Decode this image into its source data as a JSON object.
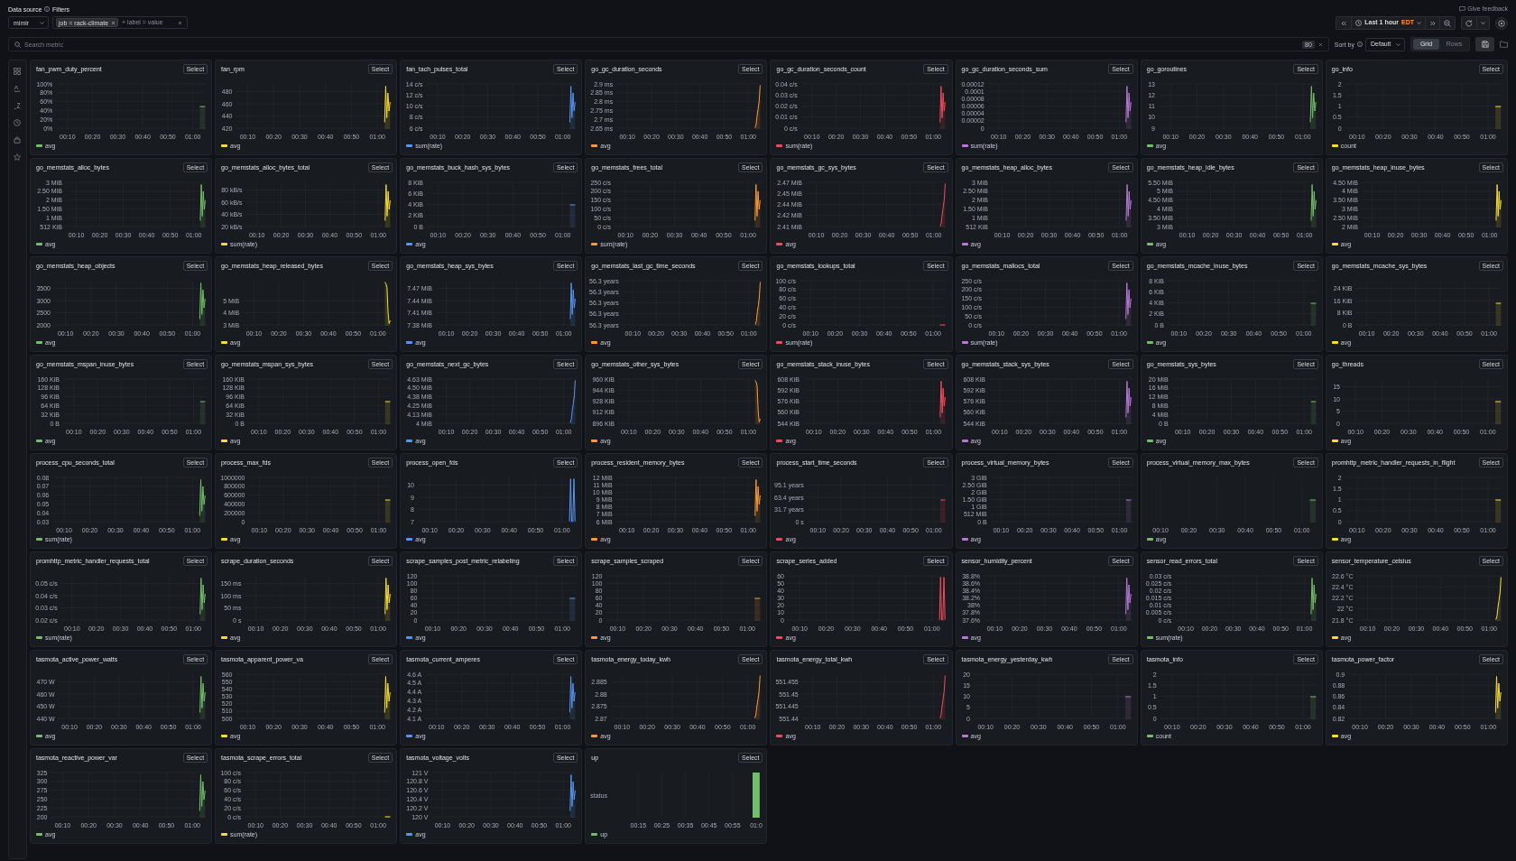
{
  "toolbar": {
    "datasource": {
      "label": "Data source",
      "value": "mimir"
    },
    "filters": {
      "label": "Filters",
      "chips": [
        "job = rack-climate"
      ],
      "placeholder": "+ label = value"
    },
    "feedback": "Give feedback",
    "time_range": {
      "value": "Last 1 hour",
      "timezone": "EDT"
    }
  },
  "search": {
    "placeholder": "Search metric",
    "count": "80"
  },
  "sort": {
    "label": "Sort by",
    "value": "Default"
  },
  "view_modes": [
    {
      "label": "Grid",
      "selected": true
    },
    {
      "label": "Rows",
      "selected": false
    }
  ],
  "panels": [
    {
      "kind": "flat",
      "title": "fan_pwm_duty_percent",
      "action": "Select",
      "y_ticks": [
        "100%",
        "80%",
        "60%",
        "40%",
        "20%",
        "0%"
      ],
      "x_ticks": [
        "00:10",
        "00:20",
        "00:30",
        "00:40",
        "00:50",
        "01:00"
      ],
      "legend": [
        {
          "label": "avg",
          "color": "#73bf69"
        }
      ]
    },
    {
      "kind": "spikes",
      "title": "fan_rpm",
      "action": "Select",
      "y_ticks": [
        "480",
        "460",
        "440",
        "420"
      ],
      "x_ticks": [
        "00:10",
        "00:20",
        "00:30",
        "00:40",
        "00:50",
        "01:00"
      ],
      "legend": [
        {
          "label": "avg",
          "color": "#fade2a"
        }
      ]
    },
    {
      "kind": "spikes",
      "title": "fan_tach_pulses_total",
      "action": "Select",
      "y_ticks": [
        "14 c/s",
        "12 c/s",
        "10 c/s",
        "8 c/s",
        "6 c/s"
      ],
      "x_ticks": [
        "00:10",
        "00:20",
        "00:30",
        "00:40",
        "00:50",
        "01:00"
      ],
      "legend": [
        {
          "label": "sum(rate)",
          "color": "#5794f2"
        }
      ]
    },
    {
      "kind": "rise",
      "title": "go_gc_duration_seconds",
      "action": "Select",
      "y_ticks": [
        "2.9 ms",
        "2.85 ms",
        "2.8 ms",
        "2.75 ms",
        "2.7 ms",
        "2.65 ms"
      ],
      "x_ticks": [
        "00:10",
        "00:20",
        "00:30",
        "00:40",
        "00:50",
        "01:00"
      ],
      "legend": [
        {
          "label": "avg",
          "color": "#ff9830"
        }
      ]
    },
    {
      "kind": "spikes",
      "title": "go_gc_duration_seconds_count",
      "action": "Select",
      "y_ticks": [
        "0.04 c/s",
        "0.03 c/s",
        "0.02 c/s",
        "0.01 c/s",
        "0 c/s"
      ],
      "x_ticks": [
        "00:10",
        "00:20",
        "00:30",
        "00:40",
        "00:50",
        "01:00"
      ],
      "legend": [
        {
          "label": "sum(rate)",
          "color": "#f2495c"
        }
      ]
    },
    {
      "kind": "spikes",
      "title": "go_gc_duration_seconds_sum",
      "action": "Select",
      "y_ticks": [
        "0.00012",
        "0.0001",
        "0.00008",
        "0.00006",
        "0.00004",
        "0.00002",
        "0"
      ],
      "x_ticks": [
        "00:10",
        "00:20",
        "00:30",
        "00:40",
        "00:50",
        "01:00"
      ],
      "legend": [
        {
          "label": "sum(rate)",
          "color": "#b877d9"
        }
      ]
    },
    {
      "kind": "spikes",
      "title": "go_goroutines",
      "action": "Select",
      "y_ticks": [
        "13",
        "12",
        "11",
        "10",
        "9"
      ],
      "x_ticks": [
        "00:10",
        "00:20",
        "00:30",
        "00:40",
        "00:50",
        "01:00"
      ],
      "legend": [
        {
          "label": "avg",
          "color": "#73bf69"
        }
      ]
    },
    {
      "kind": "flat",
      "title": "go_info",
      "action": "Select",
      "y_ticks": [
        "2",
        "1.5",
        "1",
        "0.5",
        "0"
      ],
      "x_ticks": [
        "00:10",
        "00:20",
        "00:30",
        "00:40",
        "00:50",
        "01:00"
      ],
      "legend": [
        {
          "label": "count",
          "color": "#fade2a"
        }
      ]
    },
    {
      "kind": "spikes",
      "title": "go_memstats_alloc_bytes",
      "action": "Select",
      "y_ticks": [
        "3 MiB",
        "2.50 MiB",
        "2 MiB",
        "1.50 MiB",
        "1 MiB",
        "512 KiB"
      ],
      "x_ticks": [
        "00:10",
        "00:20",
        "00:30",
        "00:40",
        "00:50",
        "01:00"
      ],
      "legend": [
        {
          "label": "avg",
          "color": "#73bf69"
        }
      ]
    },
    {
      "kind": "spikes",
      "title": "go_memstats_alloc_bytes_total",
      "action": "Select",
      "y_ticks": [
        "80 kB/s",
        "60 kB/s",
        "40 kB/s",
        "20 kB/s"
      ],
      "x_ticks": [
        "00:10",
        "00:20",
        "00:30",
        "00:40",
        "00:50",
        "01:00"
      ],
      "legend": [
        {
          "label": "sum(rate)",
          "color": "#fade2a"
        }
      ]
    },
    {
      "kind": "flat",
      "title": "go_memstats_buck_hash_sys_bytes",
      "action": "Select",
      "y_ticks": [
        "8 KiB",
        "6 KiB",
        "4 KiB",
        "2 KiB",
        "0 B"
      ],
      "x_ticks": [
        "00:10",
        "00:20",
        "00:30",
        "00:40",
        "00:50",
        "01:00"
      ],
      "legend": [
        {
          "label": "avg",
          "color": "#5794f2"
        }
      ]
    },
    {
      "kind": "spikes",
      "title": "go_memstats_frees_total",
      "action": "Select",
      "y_ticks": [
        "250 c/s",
        "200 c/s",
        "150 c/s",
        "100 c/s",
        "50 c/s",
        "0 c/s"
      ],
      "x_ticks": [
        "00:10",
        "00:20",
        "00:30",
        "00:40",
        "00:50",
        "01:00"
      ],
      "legend": [
        {
          "label": "sum(rate)",
          "color": "#ff9830"
        }
      ]
    },
    {
      "kind": "rise",
      "title": "go_memstats_gc_sys_bytes",
      "action": "Select",
      "y_ticks": [
        "2.47 MiB",
        "2.45 MiB",
        "2.44 MiB",
        "2.42 MiB",
        "2.41 MiB"
      ],
      "x_ticks": [
        "00:10",
        "00:20",
        "00:30",
        "00:40",
        "00:50",
        "01:00"
      ],
      "legend": [
        {
          "label": "avg",
          "color": "#f2495c"
        }
      ]
    },
    {
      "kind": "spikes",
      "title": "go_memstats_heap_alloc_bytes",
      "action": "Select",
      "y_ticks": [
        "3 MiB",
        "2.50 MiB",
        "2 MiB",
        "1.50 MiB",
        "1 MiB",
        "512 KiB"
      ],
      "x_ticks": [
        "00:10",
        "00:20",
        "00:30",
        "00:40",
        "00:50",
        "01:00"
      ],
      "legend": [
        {
          "label": "avg",
          "color": "#b877d9"
        }
      ]
    },
    {
      "kind": "spikes",
      "title": "go_memstats_heap_idle_bytes",
      "action": "Select",
      "y_ticks": [
        "5.50 MiB",
        "5 MiB",
        "4.50 MiB",
        "4 MiB",
        "3.50 MiB",
        "3 MiB"
      ],
      "x_ticks": [
        "00:10",
        "00:20",
        "00:30",
        "00:40",
        "00:50",
        "01:00"
      ],
      "legend": [
        {
          "label": "avg",
          "color": "#73bf69"
        }
      ]
    },
    {
      "kind": "spikes",
      "title": "go_memstats_heap_inuse_bytes",
      "action": "Select",
      "y_ticks": [
        "4.50 MiB",
        "4 MiB",
        "3.50 MiB",
        "3 MiB",
        "2.50 MiB",
        "2 MiB"
      ],
      "x_ticks": [
        "00:10",
        "00:20",
        "00:30",
        "00:40",
        "00:50",
        "01:00"
      ],
      "legend": [
        {
          "label": "avg",
          "color": "#fade2a"
        }
      ]
    },
    {
      "kind": "spikes",
      "title": "go_memstats_heap_objects",
      "action": "Select",
      "y_ticks": [
        "3500",
        "3000",
        "2500",
        "2000"
      ],
      "x_ticks": [
        "00:10",
        "00:20",
        "00:30",
        "00:40",
        "00:50",
        "01:00"
      ],
      "legend": [
        {
          "label": "avg",
          "color": "#73bf69"
        }
      ]
    },
    {
      "kind": "fall",
      "title": "go_memstats_heap_released_bytes",
      "action": "Select",
      "y_ticks": [
        "5 MiB",
        "4 MiB",
        "3 MiB"
      ],
      "x_ticks": [
        "00:10",
        "00:20",
        "00:30",
        "00:40",
        "00:50",
        "01:00"
      ],
      "legend": [
        {
          "label": "avg",
          "color": "#fade2a"
        }
      ]
    },
    {
      "kind": "spikes",
      "title": "go_memstats_heap_sys_bytes",
      "action": "Select",
      "y_ticks": [
        "7.47 MiB",
        "7.44 MiB",
        "7.41 MiB",
        "7.38 MiB"
      ],
      "x_ticks": [
        "00:10",
        "00:20",
        "00:30",
        "00:40",
        "00:50",
        "01:00"
      ],
      "legend": [
        {
          "label": "avg",
          "color": "#5794f2"
        }
      ]
    },
    {
      "kind": "rise",
      "title": "go_memstats_last_gc_time_seconds",
      "action": "Select",
      "y_ticks": [
        "56.3 years",
        "56.3 years",
        "56.3 years",
        "56.3 years",
        "56.3 years"
      ],
      "x_ticks": [
        "00:10",
        "00:20",
        "00:30",
        "00:40",
        "00:50",
        "01:00"
      ],
      "legend": [
        {
          "label": "avg",
          "color": "#ff9830"
        }
      ]
    },
    {
      "kind": "zero",
      "title": "go_memstats_lookups_total",
      "action": "Select",
      "y_ticks": [
        "100 c/s",
        "80 c/s",
        "60 c/s",
        "40 c/s",
        "20 c/s",
        "0 c/s"
      ],
      "x_ticks": [
        "00:10",
        "00:20",
        "00:30",
        "00:40",
        "00:50",
        "01:00"
      ],
      "legend": [
        {
          "label": "sum(rate)",
          "color": "#f2495c"
        }
      ]
    },
    {
      "kind": "spikes",
      "title": "go_memstats_mallocs_total",
      "action": "Select",
      "y_ticks": [
        "250 c/s",
        "200 c/s",
        "150 c/s",
        "100 c/s",
        "50 c/s",
        "0 c/s"
      ],
      "x_ticks": [
        "00:10",
        "00:20",
        "00:30",
        "00:40",
        "00:50",
        "01:00"
      ],
      "legend": [
        {
          "label": "sum(rate)",
          "color": "#b877d9"
        }
      ]
    },
    {
      "kind": "flat",
      "title": "go_memstats_mcache_inuse_bytes",
      "action": "Select",
      "y_ticks": [
        "8 KiB",
        "6 KiB",
        "4 KiB",
        "2 KiB",
        "0 B"
      ],
      "x_ticks": [
        "00:10",
        "00:20",
        "00:30",
        "00:40",
        "00:50",
        "01:00"
      ],
      "legend": [
        {
          "label": "avg",
          "color": "#73bf69"
        }
      ]
    },
    {
      "kind": "flat",
      "title": "go_memstats_mcache_sys_bytes",
      "action": "Select",
      "y_ticks": [
        "24 KiB",
        "16 KiB",
        "8 KiB",
        "0 B"
      ],
      "x_ticks": [
        "00:10",
        "00:20",
        "00:30",
        "00:40",
        "00:50",
        "01:00"
      ],
      "legend": [
        {
          "label": "avg",
          "color": "#fade2a"
        }
      ]
    },
    {
      "kind": "flat",
      "title": "go_memstats_mspan_inuse_bytes",
      "action": "Select",
      "y_ticks": [
        "160 KiB",
        "128 KiB",
        "96 KiB",
        "64 KiB",
        "32 KiB",
        "0 B"
      ],
      "x_ticks": [
        "00:10",
        "00:20",
        "00:30",
        "00:40",
        "00:50",
        "01:00"
      ],
      "legend": [
        {
          "label": "avg",
          "color": "#73bf69"
        }
      ]
    },
    {
      "kind": "flat",
      "title": "go_memstats_mspan_sys_bytes",
      "action": "Select",
      "y_ticks": [
        "160 KiB",
        "128 KiB",
        "96 KiB",
        "64 KiB",
        "32 KiB",
        "0 B"
      ],
      "x_ticks": [
        "00:10",
        "00:20",
        "00:30",
        "00:40",
        "00:50",
        "01:00"
      ],
      "legend": [
        {
          "label": "avg",
          "color": "#fade2a"
        }
      ]
    },
    {
      "kind": "rise",
      "title": "go_memstats_next_gc_bytes",
      "action": "Select",
      "y_ticks": [
        "4.63 MiB",
        "4.50 MiB",
        "4.38 MiB",
        "4.25 MiB",
        "4.13 MiB",
        "4 MiB"
      ],
      "x_ticks": [
        "00:10",
        "00:20",
        "00:30",
        "00:40",
        "00:50",
        "01:00"
      ],
      "legend": [
        {
          "label": "avg",
          "color": "#5794f2"
        }
      ]
    },
    {
      "kind": "fall",
      "title": "go_memstats_other_sys_bytes",
      "action": "Select",
      "y_ticks": [
        "960 KiB",
        "944 KiB",
        "928 KiB",
        "912 KiB",
        "896 KiB"
      ],
      "x_ticks": [
        "00:10",
        "00:20",
        "00:30",
        "00:40",
        "00:50",
        "01:00"
      ],
      "legend": [
        {
          "label": "avg",
          "color": "#ff9830"
        }
      ]
    },
    {
      "kind": "spikes",
      "title": "go_memstats_stack_inuse_bytes",
      "action": "Select",
      "y_ticks": [
        "608 KiB",
        "592 KiB",
        "576 KiB",
        "560 KiB",
        "544 KiB"
      ],
      "x_ticks": [
        "00:10",
        "00:20",
        "00:30",
        "00:40",
        "00:50",
        "01:00"
      ],
      "legend": [
        {
          "label": "avg",
          "color": "#f2495c"
        }
      ]
    },
    {
      "kind": "spikes",
      "title": "go_memstats_stack_sys_bytes",
      "action": "Select",
      "y_ticks": [
        "608 KiB",
        "592 KiB",
        "576 KiB",
        "560 KiB",
        "544 KiB"
      ],
      "x_ticks": [
        "00:10",
        "00:20",
        "00:30",
        "00:40",
        "00:50",
        "01:00"
      ],
      "legend": [
        {
          "label": "avg",
          "color": "#b877d9"
        }
      ]
    },
    {
      "kind": "flat",
      "title": "go_memstats_sys_bytes",
      "action": "Select",
      "y_ticks": [
        "20 MiB",
        "16 MiB",
        "12 MiB",
        "8 MiB",
        "4 MiB",
        "0 B"
      ],
      "x_ticks": [
        "00:10",
        "00:20",
        "00:30",
        "00:40",
        "00:50",
        "01:00"
      ],
      "legend": [
        {
          "label": "avg",
          "color": "#73bf69"
        }
      ]
    },
    {
      "kind": "flat",
      "title": "go_threads",
      "action": "Select",
      "y_ticks": [
        "15",
        "10",
        "5",
        "0"
      ],
      "x_ticks": [
        "00:10",
        "00:20",
        "00:30",
        "00:40",
        "00:50",
        "01:00"
      ],
      "legend": [
        {
          "label": "avg",
          "color": "#fade2a"
        }
      ]
    },
    {
      "kind": "spikes",
      "title": "process_cpu_seconds_total",
      "action": "Select",
      "y_ticks": [
        "0.08",
        "0.07",
        "0.06",
        "0.05",
        "0.04",
        "0.03"
      ],
      "x_ticks": [
        "00:10",
        "00:20",
        "00:30",
        "00:40",
        "00:50",
        "01:00"
      ],
      "legend": [
        {
          "label": "sum(rate)",
          "color": "#73bf69"
        }
      ]
    },
    {
      "kind": "flat",
      "title": "process_max_fds",
      "action": "Select",
      "y_ticks": [
        "1000000",
        "800000",
        "600000",
        "400000",
        "200000",
        "0"
      ],
      "x_ticks": [
        "00:10",
        "00:20",
        "00:30",
        "00:40",
        "00:50",
        "01:00"
      ],
      "legend": [
        {
          "label": "avg",
          "color": "#fade2a"
        }
      ]
    },
    {
      "kind": "pulses",
      "title": "process_open_fds",
      "action": "Select",
      "y_ticks": [
        "10",
        "9",
        "8",
        "7"
      ],
      "x_ticks": [
        "00:10",
        "00:20",
        "00:30",
        "00:40",
        "00:50",
        "01:00"
      ],
      "legend": [
        {
          "label": "avg",
          "color": "#5794f2"
        }
      ]
    },
    {
      "kind": "spikes",
      "title": "process_resident_memory_bytes",
      "action": "Select",
      "y_ticks": [
        "12 MiB",
        "11 MiB",
        "10 MiB",
        "9 MiB",
        "8 MiB",
        "7 MiB",
        "6 MiB"
      ],
      "x_ticks": [
        "00:10",
        "00:20",
        "00:30",
        "00:40",
        "00:50",
        "01:00"
      ],
      "legend": [
        {
          "label": "avg",
          "color": "#ff9830"
        }
      ]
    },
    {
      "kind": "flat",
      "title": "process_start_time_seconds",
      "action": "Select",
      "y_ticks": [
        "95.1 years",
        "63.4 years",
        "31.7 years",
        "0 s"
      ],
      "x_ticks": [
        "00:10",
        "00:20",
        "00:30",
        "00:40",
        "00:50",
        "01:00"
      ],
      "legend": [
        {
          "label": "avg",
          "color": "#f2495c"
        }
      ]
    },
    {
      "kind": "flat",
      "title": "process_virtual_memory_bytes",
      "action": "Select",
      "y_ticks": [
        "3 GiB",
        "2.50 GiB",
        "2 GiB",
        "1.50 GiB",
        "1 GiB",
        "512 MiB",
        "0 B"
      ],
      "x_ticks": [
        "00:10",
        "00:20",
        "00:30",
        "00:40",
        "00:50",
        "01:00"
      ],
      "legend": [
        {
          "label": "avg",
          "color": "#b877d9"
        }
      ]
    },
    {
      "kind": "flat",
      "title": "process_virtual_memory_max_bytes",
      "action": "Select",
      "x_ticks": [
        "00:10",
        "00:20",
        "00:30",
        "00:40",
        "00:50",
        "01:00"
      ],
      "legend": [
        {
          "label": "avg",
          "color": "#73bf69"
        }
      ]
    },
    {
      "kind": "flat",
      "title": "promhttp_metric_handler_requests_in_flight",
      "action": "Select",
      "y_ticks": [
        "2",
        "1.5",
        "1",
        "0.5",
        "0"
      ],
      "x_ticks": [
        "00:10",
        "00:20",
        "00:30",
        "00:40",
        "00:50",
        "01:00"
      ],
      "legend": [
        {
          "label": "avg",
          "color": "#fade2a"
        }
      ]
    },
    {
      "kind": "spikes",
      "title": "promhttp_metric_handler_requests_total",
      "action": "Select",
      "y_ticks": [
        "0.05 c/s",
        "0.04 c/s",
        "0.03 c/s",
        "0.02 c/s"
      ],
      "x_ticks": [
        "00:10",
        "00:20",
        "00:30",
        "00:40",
        "00:50",
        "01:00"
      ],
      "legend": [
        {
          "label": "sum(rate)",
          "color": "#73bf69"
        }
      ]
    },
    {
      "kind": "spikes",
      "title": "scrape_duration_seconds",
      "action": "Select",
      "y_ticks": [
        "150 ms",
        "100 ms",
        "50 ms",
        "0 s"
      ],
      "x_ticks": [
        "00:10",
        "00:20",
        "00:30",
        "00:40",
        "00:50",
        "01:00"
      ],
      "legend": [
        {
          "label": "avg",
          "color": "#fade2a"
        }
      ]
    },
    {
      "kind": "flat",
      "title": "scrape_samples_post_metric_relabeling",
      "action": "Select",
      "y_ticks": [
        "120",
        "100",
        "80",
        "60",
        "40",
        "20",
        "0"
      ],
      "x_ticks": [
        "00:10",
        "00:20",
        "00:30",
        "00:40",
        "00:50",
        "01:00"
      ],
      "legend": [
        {
          "label": "avg",
          "color": "#5794f2"
        }
      ]
    },
    {
      "kind": "flat",
      "title": "scrape_samples_scraped",
      "action": "Select",
      "y_ticks": [
        "120",
        "100",
        "80",
        "60",
        "40",
        "20",
        "0"
      ],
      "x_ticks": [
        "00:10",
        "00:20",
        "00:30",
        "00:40",
        "00:50",
        "01:00"
      ],
      "legend": [
        {
          "label": "avg",
          "color": "#ff9830"
        }
      ]
    },
    {
      "kind": "pulses",
      "title": "scrape_series_added",
      "action": "Select",
      "y_ticks": [
        "60",
        "50",
        "40",
        "30",
        "20",
        "10",
        "0"
      ],
      "x_ticks": [
        "00:10",
        "00:20",
        "00:30",
        "00:40",
        "00:50",
        "01:00"
      ],
      "legend": [
        {
          "label": "avg",
          "color": "#f2495c"
        }
      ]
    },
    {
      "kind": "spikes",
      "title": "sensor_humidity_percent",
      "action": "Select",
      "y_ticks": [
        "38.8%",
        "38.6%",
        "38.4%",
        "38.2%",
        "38%",
        "37.8%",
        "37.6%"
      ],
      "x_ticks": [
        "00:10",
        "00:20",
        "00:30",
        "00:40",
        "00:50",
        "01:00"
      ],
      "legend": [
        {
          "label": "avg",
          "color": "#b877d9"
        }
      ]
    },
    {
      "kind": "spikes",
      "title": "sensor_read_errors_total",
      "action": "Select",
      "y_ticks": [
        "0.03 c/s",
        "0.025 c/s",
        "0.02 c/s",
        "0.015 c/s",
        "0.01 c/s",
        "0.005 c/s",
        "0 c/s"
      ],
      "x_ticks": [
        "00:10",
        "00:20",
        "00:30",
        "00:40",
        "00:50",
        "01:00"
      ],
      "legend": [
        {
          "label": "sum(rate)",
          "color": "#73bf69"
        }
      ]
    },
    {
      "kind": "rise",
      "title": "sensor_temperature_celsius",
      "action": "Select",
      "y_ticks": [
        "22.6 °C",
        "22.4 °C",
        "22.2 °C",
        "22 °C",
        "21.8 °C"
      ],
      "x_ticks": [
        "00:10",
        "00:20",
        "00:30",
        "00:40",
        "00:50",
        "01:00"
      ],
      "legend": [
        {
          "label": "avg",
          "color": "#fade2a"
        }
      ]
    },
    {
      "kind": "spikes",
      "title": "tasmota_active_power_watts",
      "action": "Select",
      "y_ticks": [
        "470 W",
        "460 W",
        "450 W",
        "440 W"
      ],
      "x_ticks": [
        "00:10",
        "00:20",
        "00:30",
        "00:40",
        "00:50",
        "01:00"
      ],
      "legend": [
        {
          "label": "avg",
          "color": "#73bf69"
        }
      ]
    },
    {
      "kind": "spikes",
      "title": "tasmota_apparent_power_va",
      "action": "Select",
      "y_ticks": [
        "560",
        "550",
        "540",
        "530",
        "520",
        "510",
        "500"
      ],
      "x_ticks": [
        "00:10",
        "00:20",
        "00:30",
        "00:40",
        "00:50",
        "01:00"
      ],
      "legend": [
        {
          "label": "avg",
          "color": "#fade2a"
        }
      ]
    },
    {
      "kind": "spikes",
      "title": "tasmota_current_amperes",
      "action": "Select",
      "y_ticks": [
        "4.6 A",
        "4.5 A",
        "4.4 A",
        "4.3 A",
        "4.2 A",
        "4.1 A"
      ],
      "x_ticks": [
        "00:10",
        "00:20",
        "00:30",
        "00:40",
        "00:50",
        "01:00"
      ],
      "legend": [
        {
          "label": "avg",
          "color": "#5794f2"
        }
      ]
    },
    {
      "kind": "rise",
      "title": "tasmota_energy_today_kwh",
      "action": "Select",
      "y_ticks": [
        "2.885",
        "2.88",
        "2.875",
        "2.87"
      ],
      "x_ticks": [
        "00:10",
        "00:20",
        "00:30",
        "00:40",
        "00:50",
        "01:00"
      ],
      "legend": [
        {
          "label": "avg",
          "color": "#ff9830"
        }
      ]
    },
    {
      "kind": "rise",
      "title": "tasmota_energy_total_kwh",
      "action": "Select",
      "y_ticks": [
        "551.455",
        "551.45",
        "551.445",
        "551.44"
      ],
      "x_ticks": [
        "00:10",
        "00:20",
        "00:30",
        "00:40",
        "00:50",
        "01:00"
      ],
      "legend": [
        {
          "label": "avg",
          "color": "#f2495c"
        }
      ]
    },
    {
      "kind": "flat",
      "title": "tasmota_energy_yesterday_kwh",
      "action": "Select",
      "y_ticks": [
        "20",
        "15",
        "10",
        "5",
        "0"
      ],
      "x_ticks": [
        "00:10",
        "00:20",
        "00:30",
        "00:40",
        "00:50",
        "01:00"
      ],
      "legend": [
        {
          "label": "avg",
          "color": "#b877d9"
        }
      ]
    },
    {
      "kind": "flat",
      "title": "tasmota_info",
      "action": "Select",
      "y_ticks": [
        "2",
        "1.5",
        "1",
        "0.5",
        "0"
      ],
      "x_ticks": [
        "00:10",
        "00:20",
        "00:30",
        "00:40",
        "00:50",
        "01:00"
      ],
      "legend": [
        {
          "label": "count",
          "color": "#73bf69"
        }
      ]
    },
    {
      "kind": "spikes",
      "title": "tasmota_power_factor",
      "action": "Select",
      "y_ticks": [
        "0.9",
        "0.88",
        "0.86",
        "0.84",
        "0.82"
      ],
      "x_ticks": [
        "00:10",
        "00:20",
        "00:30",
        "00:40",
        "00:50",
        "01:00"
      ],
      "legend": [
        {
          "label": "avg",
          "color": "#fade2a"
        }
      ]
    },
    {
      "kind": "spikes",
      "title": "tasmota_reactive_power_var",
      "action": "Select",
      "y_ticks": [
        "325",
        "300",
        "275",
        "250",
        "225",
        "200"
      ],
      "x_ticks": [
        "00:10",
        "00:20",
        "00:30",
        "00:40",
        "00:50",
        "01:00"
      ],
      "legend": [
        {
          "label": "avg",
          "color": "#73bf69"
        }
      ]
    },
    {
      "kind": "zero",
      "title": "tasmota_scrape_errors_total",
      "action": "Select",
      "y_ticks": [
        "100 c/s",
        "80 c/s",
        "60 c/s",
        "40 c/s",
        "20 c/s",
        "0 c/s"
      ],
      "x_ticks": [
        "00:10",
        "00:20",
        "00:30",
        "00:40",
        "00:50",
        "01:00"
      ],
      "legend": [
        {
          "label": "sum(rate)",
          "color": "#fade2a"
        }
      ]
    },
    {
      "kind": "spikes",
      "title": "tasmota_voltage_volts",
      "action": "Select",
      "y_ticks": [
        "121 V",
        "120.8 V",
        "120.6 V",
        "120.4 V",
        "120.2 V",
        "120 V"
      ],
      "x_ticks": [
        "00:10",
        "00:20",
        "00:30",
        "00:40",
        "00:50",
        "01:00"
      ],
      "legend": [
        {
          "label": "avg",
          "color": "#5794f2"
        }
      ]
    },
    {
      "kind": "state",
      "title": "up",
      "action": "Select",
      "y_ticks": [
        "status"
      ],
      "x_ticks": [
        "00:15",
        "00:25",
        "00:35",
        "00:45",
        "00:55",
        "01:0"
      ],
      "legend": [
        {
          "label": "up",
          "color": "#73bf69"
        }
      ]
    }
  ]
}
